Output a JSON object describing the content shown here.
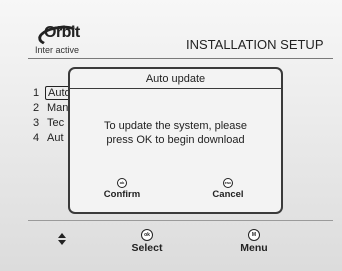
{
  "header": {
    "logo_word": "Orbit",
    "logo_sub": "Inter active",
    "title": "INSTALLATION SETUP"
  },
  "menu": {
    "items": [
      {
        "num": "1",
        "label": "Auto"
      },
      {
        "num": "2",
        "label": "Man"
      },
      {
        "num": "3",
        "label": "Tec"
      },
      {
        "num": "4",
        "label": "Aut"
      }
    ],
    "selected_index": 0
  },
  "dialog": {
    "title": "Auto update",
    "message_line1": "To update the system, please",
    "message_line2": "press OK to begin download",
    "confirm": {
      "icon_text": "ok",
      "label": "Confirm"
    },
    "cancel": {
      "icon_text": "esc",
      "label": "Cancel"
    }
  },
  "footer": {
    "select": {
      "icon_text": "ok",
      "label": "Select"
    },
    "menu": {
      "icon_text": "M",
      "label": "Menu"
    }
  },
  "icons": {
    "nav": "up-down-arrows-icon",
    "ok": "ok-key-icon",
    "esc": "esc-key-icon",
    "menu": "menu-key-icon"
  }
}
